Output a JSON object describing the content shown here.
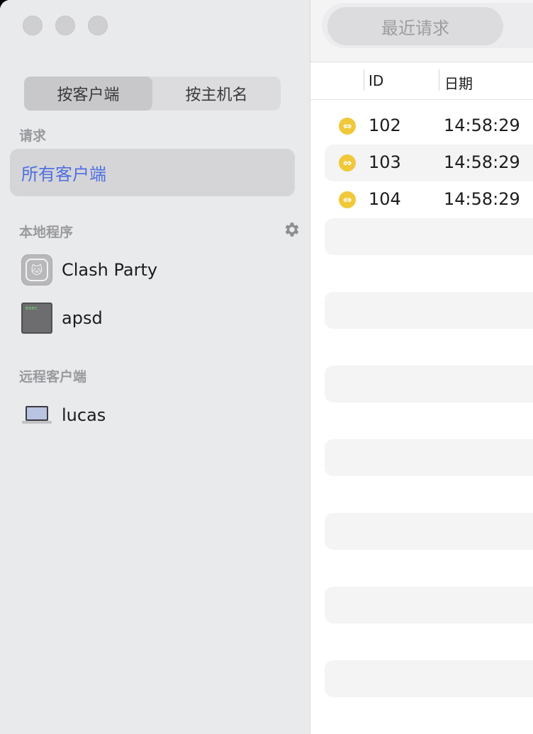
{
  "sidebar": {
    "segmented": {
      "by_client": "按客户端",
      "by_host": "按主机名"
    },
    "requests_label": "请求",
    "all_clients": "所有客户端",
    "local_programs_label": "本地程序",
    "local_programs": [
      {
        "name": "Clash Party",
        "icon": "clash-party-app-icon"
      },
      {
        "name": "apsd",
        "icon": "exec-terminal-icon"
      }
    ],
    "remote_clients_label": "远程客户端",
    "remote_clients": [
      {
        "name": "lucas",
        "icon": "laptop-icon"
      }
    ]
  },
  "toolbar": {
    "recent_requests": "最近请求"
  },
  "table": {
    "columns": {
      "id": "ID",
      "date": "日期"
    },
    "rows": [
      {
        "id": "102",
        "time": "14:58:29",
        "status": "pending"
      },
      {
        "id": "103",
        "time": "14:58:29",
        "status": "pending"
      },
      {
        "id": "104",
        "time": "14:58:29",
        "status": "pending"
      }
    ]
  },
  "colors": {
    "accent": "#4f6fe0",
    "status_pending": "#f0c83a"
  }
}
